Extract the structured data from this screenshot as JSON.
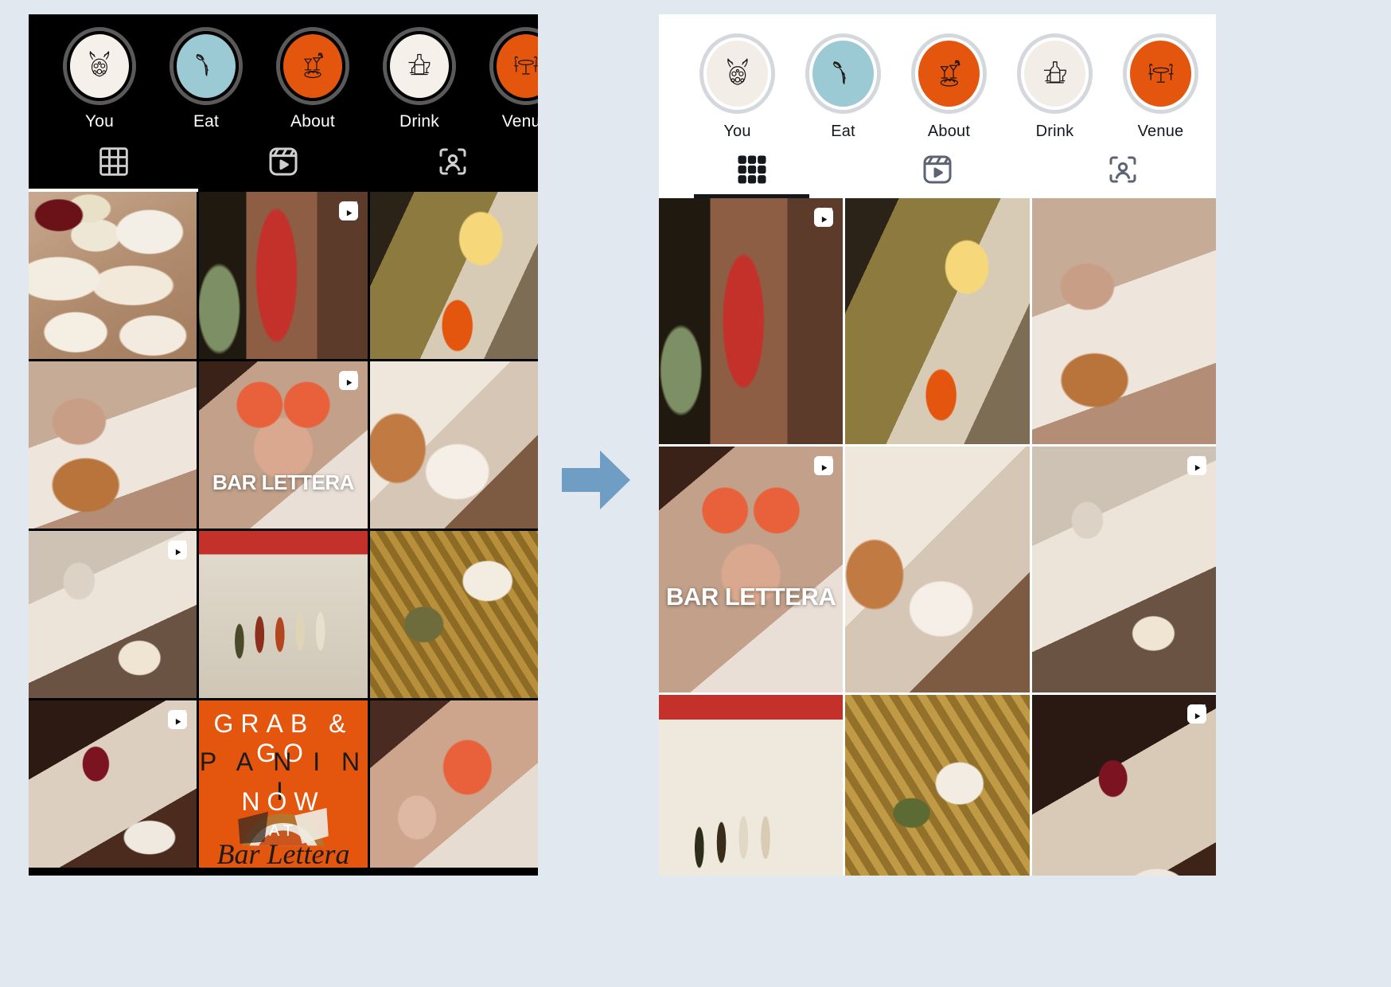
{
  "background_color": "#e2e8ef",
  "accent_orange": "#e4550e",
  "accent_teal": "#9bc9d4",
  "arrow": {
    "color": "#6f9dc4",
    "name": "transition-arrow",
    "direction": "right"
  },
  "left_panel": {
    "theme": "dark",
    "background": "#000000",
    "stories": [
      {
        "label": "You",
        "icon": "deer-floral-icon",
        "bg": "#f5f1ea"
      },
      {
        "label": "Eat",
        "icon": "fork-pasta-icon",
        "bg": "#9bc9d4"
      },
      {
        "label": "About",
        "icon": "cocktail-plate-icon",
        "bg": "#e4550e"
      },
      {
        "label": "Drink",
        "icon": "wine-bottle-glass-icon",
        "bg": "#f5f1ea"
      },
      {
        "label": "Venue",
        "icon": "table-chairs-icon",
        "bg": "#e4550e"
      }
    ],
    "tabs": [
      {
        "name": "grid-tab",
        "icon": "grid-icon",
        "active": true
      },
      {
        "name": "reels-tab",
        "icon": "reels-icon",
        "active": false
      },
      {
        "name": "tagged-tab",
        "icon": "tagged-user-icon",
        "active": false
      }
    ],
    "grid": [
      {
        "name": "post-food-spread",
        "fill": "ph-spread",
        "reel": false,
        "caption": ""
      },
      {
        "name": "post-bar-sign",
        "fill": "ph-sign",
        "reel": true,
        "caption": ""
      },
      {
        "name": "post-storefront",
        "fill": "ph-front",
        "reel": false,
        "caption": ""
      },
      {
        "name": "post-sandwich-bite",
        "fill": "ph-bite",
        "reel": false,
        "caption": ""
      },
      {
        "name": "post-cheers",
        "fill": "ph-cheers",
        "reel": true,
        "caption": "BAR LETTERA"
      },
      {
        "name": "post-plated-dish",
        "fill": "ph-plate",
        "reel": false,
        "caption": ""
      },
      {
        "name": "post-cocktail-pour",
        "fill": "ph-pour",
        "reel": true,
        "caption": ""
      },
      {
        "name": "post-bottle-shelf",
        "fill": "ph-bottles",
        "reel": false,
        "caption": ""
      },
      {
        "name": "post-olives-bread",
        "fill": "ph-olives",
        "reel": false,
        "caption": ""
      },
      {
        "name": "post-wine-dinner",
        "fill": "ph-wine",
        "reel": true,
        "caption": ""
      },
      {
        "name": "post-panini-promo",
        "fill": "promo",
        "reel": false,
        "caption": ""
      },
      {
        "name": "post-rose-toast",
        "fill": "ph-rose",
        "reel": false,
        "caption": ""
      }
    ],
    "promo": {
      "line1": "GRAB  &  GO",
      "line2": "P A N I N I",
      "line3": "NOW",
      "line4": "AT",
      "signature": "Bar Lettera"
    }
  },
  "right_panel": {
    "theme": "light",
    "background": "#ffffff",
    "stories": [
      {
        "label": "You",
        "icon": "deer-floral-icon",
        "bg": "#f2ede6"
      },
      {
        "label": "Eat",
        "icon": "fork-pasta-icon",
        "bg": "#9bc9d4"
      },
      {
        "label": "About",
        "icon": "cocktail-plate-icon",
        "bg": "#e4550e"
      },
      {
        "label": "Drink",
        "icon": "wine-bottle-glass-icon",
        "bg": "#f2ede6"
      },
      {
        "label": "Venue",
        "icon": "table-chairs-icon",
        "bg": "#e4550e"
      }
    ],
    "tabs": [
      {
        "name": "grid-tab",
        "icon": "grid-icon",
        "active": true
      },
      {
        "name": "reels-tab",
        "icon": "reels-icon",
        "active": false
      },
      {
        "name": "tagged-tab",
        "icon": "tagged-user-icon",
        "active": false
      }
    ],
    "grid": [
      {
        "name": "post-bar-sign",
        "fill": "ph-sign",
        "reel": true,
        "caption": ""
      },
      {
        "name": "post-storefront",
        "fill": "ph-front",
        "reel": false,
        "caption": ""
      },
      {
        "name": "post-sandwich-bite",
        "fill": "ph-bite",
        "reel": false,
        "caption": ""
      },
      {
        "name": "post-cheers",
        "fill": "ph-cheers",
        "reel": true,
        "caption": "BAR LETTERA"
      },
      {
        "name": "post-plated-dish",
        "fill": "ph-plate",
        "reel": false,
        "caption": ""
      },
      {
        "name": "post-cocktail-pour",
        "fill": "ph-pour",
        "reel": true,
        "caption": ""
      },
      {
        "name": "post-bottle-shelf",
        "fill": "ph-shelf",
        "reel": false,
        "caption": ""
      },
      {
        "name": "post-olives-bread",
        "fill": "ph-green",
        "reel": false,
        "caption": ""
      },
      {
        "name": "post-wine-dinner",
        "fill": "ph-table",
        "reel": true,
        "caption": ""
      }
    ]
  }
}
